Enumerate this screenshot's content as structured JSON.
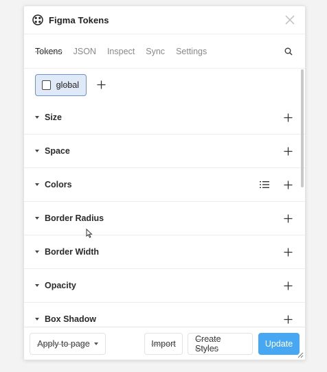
{
  "window": {
    "title": "Figma Tokens"
  },
  "tabs": [
    {
      "label": "Tokens",
      "active": true
    },
    {
      "label": "JSON"
    },
    {
      "label": "Inspect"
    },
    {
      "label": "Sync"
    },
    {
      "label": "Settings"
    }
  ],
  "themes": {
    "active_label": "global"
  },
  "token_groups": [
    {
      "label": "Size"
    },
    {
      "label": "Space"
    },
    {
      "label": "Colors",
      "has_list_icon": true
    },
    {
      "label": "Border Radius"
    },
    {
      "label": "Border Width"
    },
    {
      "label": "Opacity"
    },
    {
      "label": "Box Shadow"
    }
  ],
  "footer": {
    "apply_label": "Apply to page",
    "import_label": "Import",
    "create_styles_label": "Create Styles",
    "update_label": "Update"
  },
  "colors": {
    "accent": "#48a7f2",
    "chip_bg": "#dfe9f7",
    "chip_border": "#6d8fc9"
  },
  "icons": [
    "figma-logo-icon",
    "close-icon",
    "search-icon",
    "plus-icon",
    "list-icon",
    "caret-down-icon",
    "chevron-down-icon",
    "resize-grip-icon"
  ]
}
